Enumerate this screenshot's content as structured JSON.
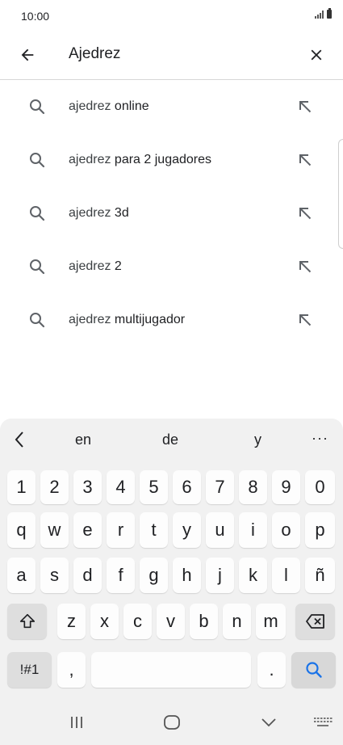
{
  "status": {
    "time": "10:00"
  },
  "search": {
    "query": "Ajedrez"
  },
  "suggestions": [
    {
      "prefix": "ajedrez",
      "suffix": " online"
    },
    {
      "prefix": "ajedrez",
      "suffix": " para 2 jugadores"
    },
    {
      "prefix": "ajedrez",
      "suffix": " 3d"
    },
    {
      "prefix": "ajedrez",
      "suffix": " 2"
    },
    {
      "prefix": "ajedrez",
      "suffix": " multijugador"
    }
  ],
  "keyboard": {
    "predictions": [
      "en",
      "de",
      "y"
    ],
    "more": "···",
    "row_numbers": [
      "1",
      "2",
      "3",
      "4",
      "5",
      "6",
      "7",
      "8",
      "9",
      "0"
    ],
    "row1": [
      "q",
      "w",
      "e",
      "r",
      "t",
      "y",
      "u",
      "i",
      "o",
      "p"
    ],
    "row2": [
      "a",
      "s",
      "d",
      "f",
      "g",
      "h",
      "j",
      "k",
      "l",
      "ñ"
    ],
    "row3": [
      "z",
      "x",
      "c",
      "v",
      "b",
      "n",
      "m"
    ],
    "symbols": "!#1",
    "comma": ",",
    "period": "."
  },
  "colors": {
    "accent": "#1a73e8",
    "keyboard_bg": "#f1f1f1",
    "key_bg": "#fdfdfd"
  }
}
